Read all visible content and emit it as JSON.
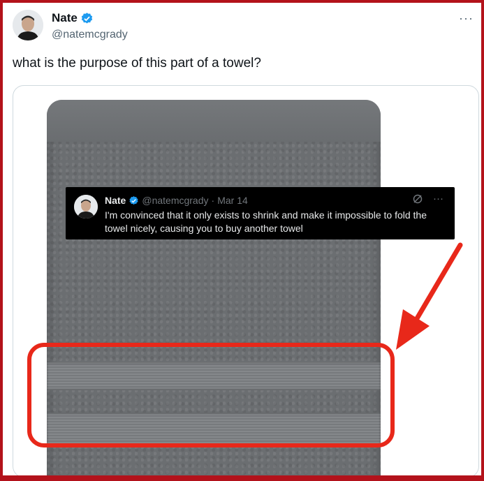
{
  "tweet": {
    "author_name": "Nate",
    "author_handle": "@natemcgrady",
    "text": "what is the purpose of this part of a towel?",
    "more_icon": "more-horizontal-icon",
    "more_glyph": "···"
  },
  "embedded_tweet": {
    "author_name": "Nate",
    "author_handle": "@natemcgrady",
    "separator": "·",
    "date": "Mar 14",
    "text": "I'm convinced that it only exists to shrink and make it impossible to fold the towel nicely, causing you to buy another towel",
    "icon_1": "no-notification-icon",
    "icon_2": "more-horizontal-icon",
    "more_glyph": "···"
  },
  "colors": {
    "frame_border": "#b3121b",
    "annotation_red": "#e8281a",
    "verified_blue": "#1d9bf0",
    "towel_gray": "#6b6e71"
  }
}
